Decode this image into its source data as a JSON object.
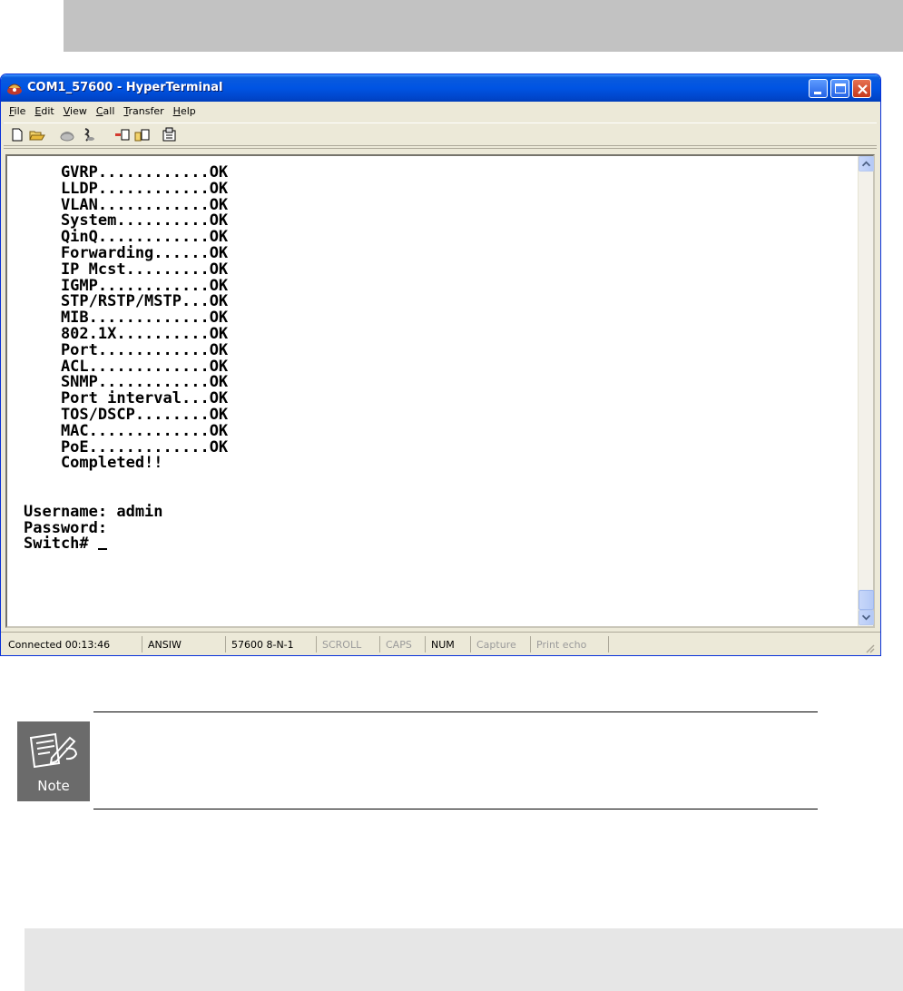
{
  "window": {
    "title": "COM1_57600 - HyperTerminal",
    "icon": "hyperterminal-phone-icon"
  },
  "menu": {
    "items": [
      {
        "accel": "F",
        "rest": "ile"
      },
      {
        "accel": "E",
        "rest": "dit"
      },
      {
        "accel": "V",
        "rest": "iew"
      },
      {
        "accel": "C",
        "rest": "all"
      },
      {
        "accel": "T",
        "rest": "ransfer"
      },
      {
        "accel": "H",
        "rest": "elp"
      }
    ]
  },
  "toolbar": {
    "icons": [
      "new-icon",
      "open-icon",
      "connect-icon",
      "disconnect-icon",
      "send-icon",
      "receive-icon",
      "properties-icon"
    ]
  },
  "terminal": {
    "lines": [
      "    GVRP............OK",
      "    LLDP............OK",
      "    VLAN............OK",
      "    System..........OK",
      "    QinQ............OK",
      "    Forwarding......OK",
      "    IP Mcst.........OK",
      "    IGMP............OK",
      "    STP/RSTP/MSTP...OK",
      "    MIB.............OK",
      "    802.1X..........OK",
      "    Port............OK",
      "    ACL.............OK",
      "    SNMP............OK",
      "    Port interval...OK",
      "    TOS/DSCP........OK",
      "    MAC.............OK",
      "    PoE.............OK",
      "    Completed!!",
      "",
      "",
      "Username: admin",
      "Password:",
      "Switch# "
    ]
  },
  "status": {
    "connected": "Connected 00:13:46",
    "emulation": "ANSIW",
    "settings": "57600 8-N-1",
    "scroll": "SCROLL",
    "caps": "CAPS",
    "num": "NUM",
    "capture": "Capture",
    "print_echo": "Print echo"
  },
  "note": {
    "label": "Note"
  },
  "colors": {
    "titlebar": "#0054e3",
    "window_face": "#ece9d8",
    "band_top": "#c2c2c2",
    "band_bottom": "#e6e6e6",
    "note_icon_bg": "#6b6b6b"
  }
}
